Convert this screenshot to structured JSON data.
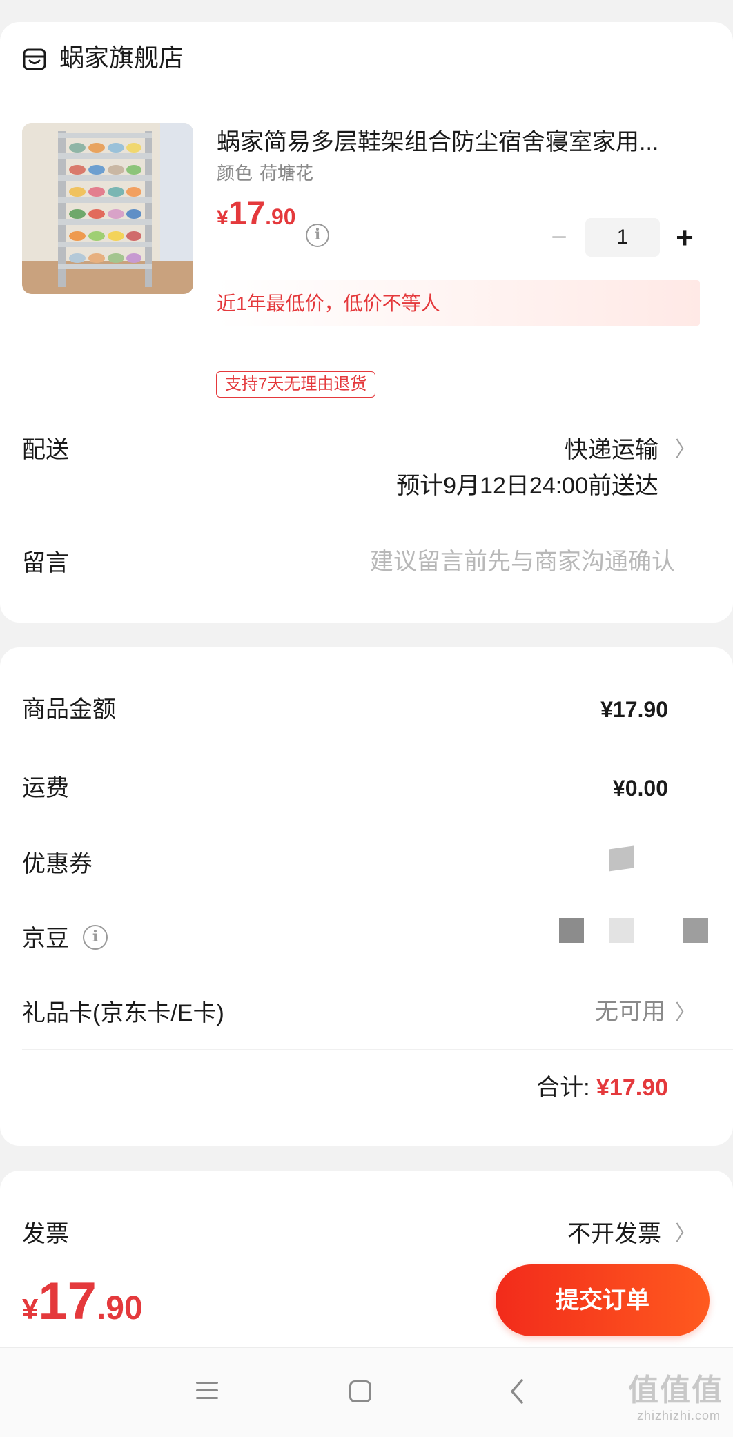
{
  "store": {
    "name": "蜗家旗舰店",
    "icon": "store-icon"
  },
  "product": {
    "title": "蜗家简易多层鞋架组合防尘宿舍寝室家用...",
    "spec_label": "颜色",
    "spec_value": "荷塘花",
    "price_currency": "¥",
    "price_int": "17",
    "price_dec": ".90",
    "quantity": "1",
    "qty_minus": "−",
    "qty_plus": "+",
    "lowest_price_text": "近1年最低价，低价不等人",
    "return_tag": "支持7天无理由退货"
  },
  "delivery": {
    "label": "配送",
    "method": "快递运输",
    "eta": "预计9月12日24:00前送达"
  },
  "message": {
    "label": "留言",
    "placeholder": "建议留言前先与商家沟通确认"
  },
  "amounts": {
    "goods_label": "商品金额",
    "goods_value": "¥17.90",
    "shipping_label": "运费",
    "shipping_value": "¥0.00",
    "coupon_label": "优惠券",
    "jd_bean_label": "京豆",
    "gift_card_label": "礼品卡(京东卡/E卡)",
    "gift_card_value": "无可用",
    "total_label": "合计:",
    "total_value": "¥17.90"
  },
  "invoice": {
    "label": "发票",
    "value": "不开发票"
  },
  "bottom": {
    "price_currency": "¥",
    "price_int": "17",
    "price_dec": ".90",
    "submit_label": "提交订单"
  },
  "chevron": "〉",
  "info_glyph": "i",
  "watermark": {
    "main": "值值值",
    "sub": "zhizhizhi.com"
  },
  "colors": {
    "accent": "#e4393c",
    "button_start": "#f22b1b",
    "button_end": "#ff5a1f",
    "background": "#f2f2f2"
  }
}
